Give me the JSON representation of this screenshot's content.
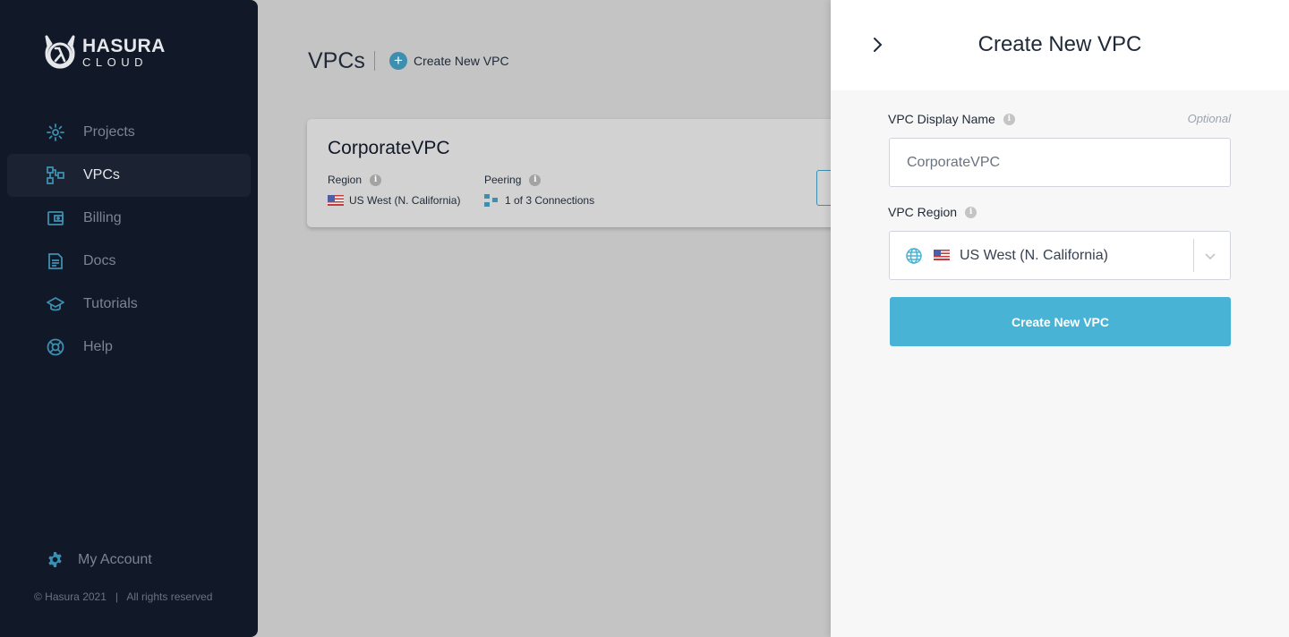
{
  "brand": {
    "line1": "HASURA",
    "line2": "CLOUD"
  },
  "sidebar": {
    "items": [
      {
        "label": "Projects",
        "icon": "projects-icon"
      },
      {
        "label": "VPCs",
        "icon": "vpcs-icon",
        "active": true
      },
      {
        "label": "Billing",
        "icon": "billing-icon"
      },
      {
        "label": "Docs",
        "icon": "docs-icon"
      },
      {
        "label": "Tutorials",
        "icon": "tutorials-icon"
      },
      {
        "label": "Help",
        "icon": "help-icon"
      }
    ],
    "account_label": "My Account",
    "copyright": "© Hasura 2021   |   All rights reserved"
  },
  "main": {
    "title": "VPCs",
    "create_label": "Create New VPC",
    "card": {
      "name": "CorporateVPC",
      "region_label": "Region",
      "region_value": "US West (N. California)",
      "peering_label": "Peering",
      "peering_value": "1 of 3 Connections"
    }
  },
  "panel": {
    "title": "Create New VPC",
    "name_label": "VPC Display Name",
    "optional_label": "Optional",
    "name_value": "CorporateVPC",
    "region_label": "VPC Region",
    "region_value": "US West (N. California)",
    "submit_label": "Create New VPC"
  },
  "colors": {
    "accent": "#48b3d5",
    "sidebar_bg": "#111827",
    "icon": "#3d8fb0"
  }
}
